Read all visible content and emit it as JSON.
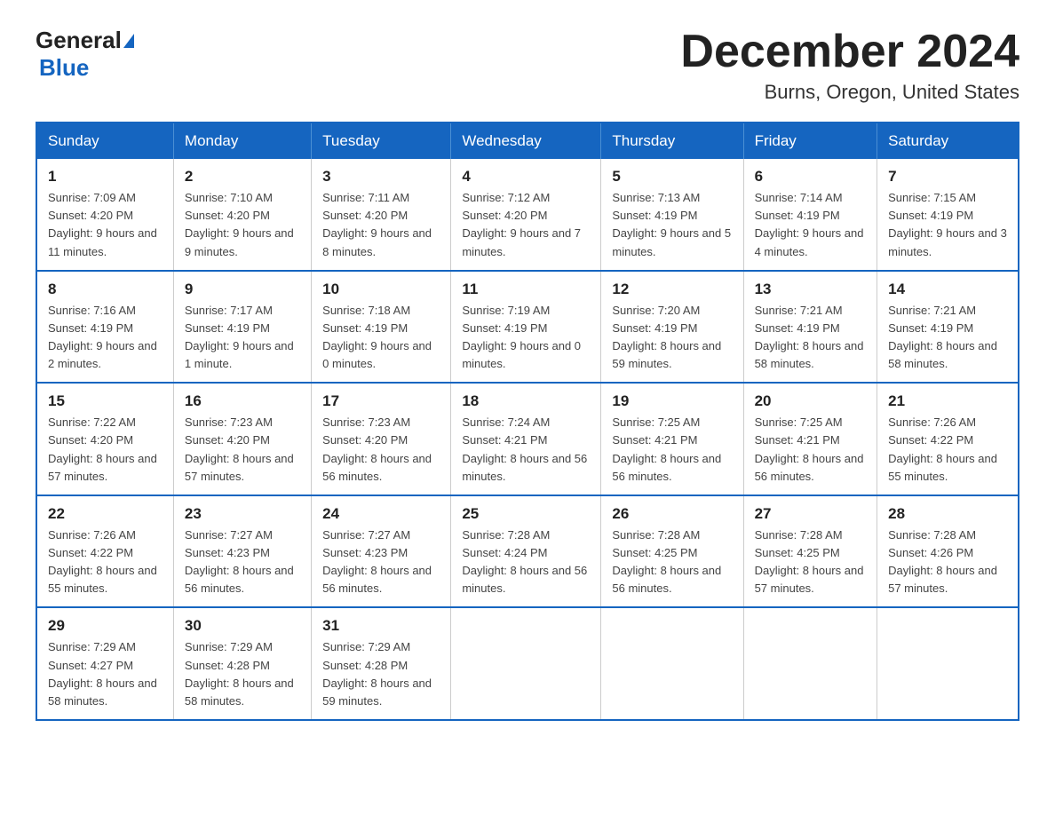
{
  "header": {
    "logo_line1": "General",
    "logo_line2": "Blue",
    "title": "December 2024",
    "subtitle": "Burns, Oregon, United States"
  },
  "days_of_week": [
    "Sunday",
    "Monday",
    "Tuesday",
    "Wednesday",
    "Thursday",
    "Friday",
    "Saturday"
  ],
  "weeks": [
    [
      {
        "day": "1",
        "sunrise": "7:09 AM",
        "sunset": "4:20 PM",
        "daylight": "9 hours and 11 minutes."
      },
      {
        "day": "2",
        "sunrise": "7:10 AM",
        "sunset": "4:20 PM",
        "daylight": "9 hours and 9 minutes."
      },
      {
        "day": "3",
        "sunrise": "7:11 AM",
        "sunset": "4:20 PM",
        "daylight": "9 hours and 8 minutes."
      },
      {
        "day": "4",
        "sunrise": "7:12 AM",
        "sunset": "4:20 PM",
        "daylight": "9 hours and 7 minutes."
      },
      {
        "day": "5",
        "sunrise": "7:13 AM",
        "sunset": "4:19 PM",
        "daylight": "9 hours and 5 minutes."
      },
      {
        "day": "6",
        "sunrise": "7:14 AM",
        "sunset": "4:19 PM",
        "daylight": "9 hours and 4 minutes."
      },
      {
        "day": "7",
        "sunrise": "7:15 AM",
        "sunset": "4:19 PM",
        "daylight": "9 hours and 3 minutes."
      }
    ],
    [
      {
        "day": "8",
        "sunrise": "7:16 AM",
        "sunset": "4:19 PM",
        "daylight": "9 hours and 2 minutes."
      },
      {
        "day": "9",
        "sunrise": "7:17 AM",
        "sunset": "4:19 PM",
        "daylight": "9 hours and 1 minute."
      },
      {
        "day": "10",
        "sunrise": "7:18 AM",
        "sunset": "4:19 PM",
        "daylight": "9 hours and 0 minutes."
      },
      {
        "day": "11",
        "sunrise": "7:19 AM",
        "sunset": "4:19 PM",
        "daylight": "9 hours and 0 minutes."
      },
      {
        "day": "12",
        "sunrise": "7:20 AM",
        "sunset": "4:19 PM",
        "daylight": "8 hours and 59 minutes."
      },
      {
        "day": "13",
        "sunrise": "7:21 AM",
        "sunset": "4:19 PM",
        "daylight": "8 hours and 58 minutes."
      },
      {
        "day": "14",
        "sunrise": "7:21 AM",
        "sunset": "4:19 PM",
        "daylight": "8 hours and 58 minutes."
      }
    ],
    [
      {
        "day": "15",
        "sunrise": "7:22 AM",
        "sunset": "4:20 PM",
        "daylight": "8 hours and 57 minutes."
      },
      {
        "day": "16",
        "sunrise": "7:23 AM",
        "sunset": "4:20 PM",
        "daylight": "8 hours and 57 minutes."
      },
      {
        "day": "17",
        "sunrise": "7:23 AM",
        "sunset": "4:20 PM",
        "daylight": "8 hours and 56 minutes."
      },
      {
        "day": "18",
        "sunrise": "7:24 AM",
        "sunset": "4:21 PM",
        "daylight": "8 hours and 56 minutes."
      },
      {
        "day": "19",
        "sunrise": "7:25 AM",
        "sunset": "4:21 PM",
        "daylight": "8 hours and 56 minutes."
      },
      {
        "day": "20",
        "sunrise": "7:25 AM",
        "sunset": "4:21 PM",
        "daylight": "8 hours and 56 minutes."
      },
      {
        "day": "21",
        "sunrise": "7:26 AM",
        "sunset": "4:22 PM",
        "daylight": "8 hours and 55 minutes."
      }
    ],
    [
      {
        "day": "22",
        "sunrise": "7:26 AM",
        "sunset": "4:22 PM",
        "daylight": "8 hours and 55 minutes."
      },
      {
        "day": "23",
        "sunrise": "7:27 AM",
        "sunset": "4:23 PM",
        "daylight": "8 hours and 56 minutes."
      },
      {
        "day": "24",
        "sunrise": "7:27 AM",
        "sunset": "4:23 PM",
        "daylight": "8 hours and 56 minutes."
      },
      {
        "day": "25",
        "sunrise": "7:28 AM",
        "sunset": "4:24 PM",
        "daylight": "8 hours and 56 minutes."
      },
      {
        "day": "26",
        "sunrise": "7:28 AM",
        "sunset": "4:25 PM",
        "daylight": "8 hours and 56 minutes."
      },
      {
        "day": "27",
        "sunrise": "7:28 AM",
        "sunset": "4:25 PM",
        "daylight": "8 hours and 57 minutes."
      },
      {
        "day": "28",
        "sunrise": "7:28 AM",
        "sunset": "4:26 PM",
        "daylight": "8 hours and 57 minutes."
      }
    ],
    [
      {
        "day": "29",
        "sunrise": "7:29 AM",
        "sunset": "4:27 PM",
        "daylight": "8 hours and 58 minutes."
      },
      {
        "day": "30",
        "sunrise": "7:29 AM",
        "sunset": "4:28 PM",
        "daylight": "8 hours and 58 minutes."
      },
      {
        "day": "31",
        "sunrise": "7:29 AM",
        "sunset": "4:28 PM",
        "daylight": "8 hours and 59 minutes."
      },
      null,
      null,
      null,
      null
    ]
  ]
}
